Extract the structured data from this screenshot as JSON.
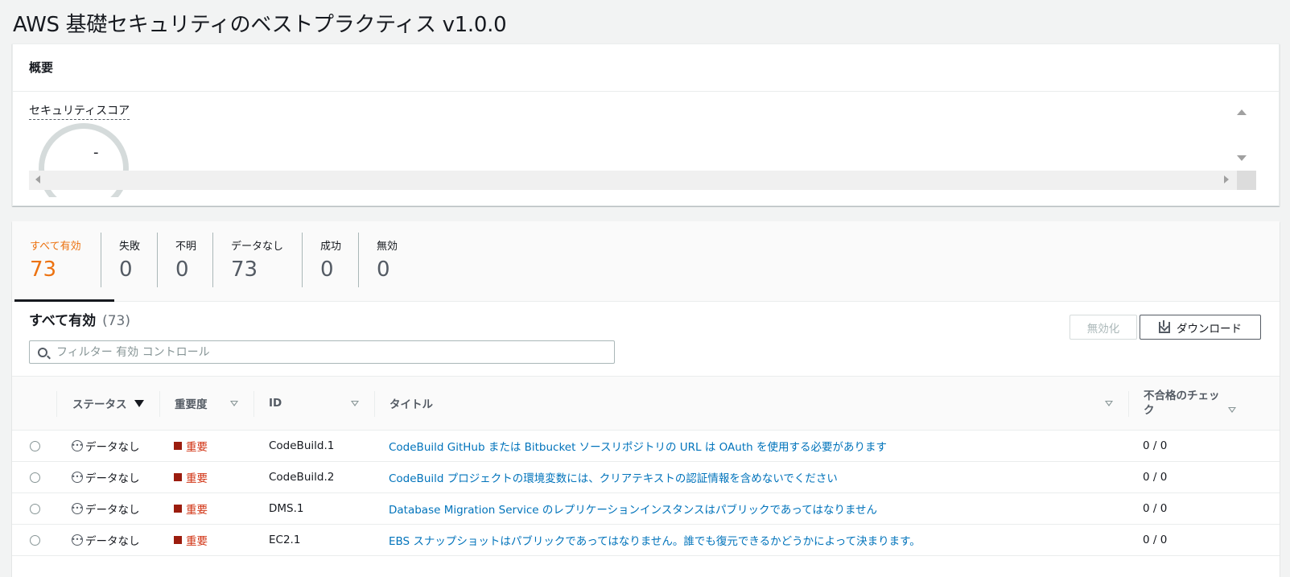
{
  "page": {
    "title": "AWS 基礎セキュリティのベストプラクティス v1.0.0"
  },
  "overview": {
    "header": "概要",
    "score_label": "セキュリティスコア",
    "score_value": "-"
  },
  "stats": [
    {
      "label": "すべて有効",
      "count": "73",
      "active": true
    },
    {
      "label": "失敗",
      "count": "0"
    },
    {
      "label": "不明",
      "count": "0"
    },
    {
      "label": "データなし",
      "count": "73"
    },
    {
      "label": "成功",
      "count": "0"
    },
    {
      "label": "無効",
      "count": "0"
    }
  ],
  "table": {
    "heading": "すべて有効",
    "heading_count": "(73)",
    "disable_button": "無効化",
    "download_button": "ダウンロード",
    "search_placeholder": "フィルター 有効 コントロール",
    "columns": {
      "status": "ステータス",
      "severity": "重要度",
      "id": "ID",
      "title": "タイトル",
      "failed_checks": "不合格のチェック"
    },
    "rows": [
      {
        "status": "データなし",
        "severity": "重要",
        "id": "CodeBuild.1",
        "title": "CodeBuild GitHub または Bitbucket ソースリポジトリの URL は OAuth を使用する必要があります",
        "checks": "0 / 0"
      },
      {
        "status": "データなし",
        "severity": "重要",
        "id": "CodeBuild.2",
        "title": "CodeBuild プロジェクトの環境変数には、クリアテキストの認証情報を含めないでください",
        "checks": "0 / 0"
      },
      {
        "status": "データなし",
        "severity": "重要",
        "id": "DMS.1",
        "title": "Database Migration Service のレプリケーションインスタンスはパブリックであってはなりません",
        "checks": "0 / 0"
      },
      {
        "status": "データなし",
        "severity": "重要",
        "id": "EC2.1",
        "title": "EBS スナップショットはパブリックであってはなりません。誰でも復元できるかどうかによって決まります。",
        "checks": "0 / 0"
      }
    ]
  },
  "colors": {
    "accent": "#ec7211",
    "link": "#0073bb",
    "critical": "#d13212"
  }
}
